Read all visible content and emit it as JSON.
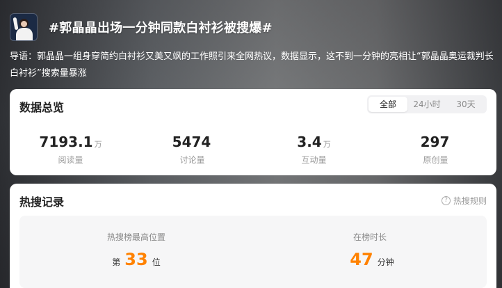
{
  "header": {
    "title": "#郭晶晶出场一分钟同款白衬衫被搜爆#"
  },
  "intro": "导语：郭晶晶一组身穿简约白衬衫又美又飒的工作照引来全网热议，数据显示，这不到一分钟的亮相让“郭晶晶奥运裁判长白衬衫”搜索量暴涨",
  "overview": {
    "title": "数据总览",
    "tabs": [
      "全部",
      "24小时",
      "30天"
    ],
    "active_tab": "全部",
    "stats": [
      {
        "value": "7193.1",
        "unit": "万",
        "label": "阅读量"
      },
      {
        "value": "5474",
        "unit": "",
        "label": "讨论量"
      },
      {
        "value": "3.4",
        "unit": "万",
        "label": "互动量"
      },
      {
        "value": "297",
        "unit": "",
        "label": "原创量"
      }
    ]
  },
  "record": {
    "title": "热搜记录",
    "rules_label": "热搜规则",
    "peak": {
      "label": "热搜榜最高位置",
      "prefix": "第",
      "value": "33",
      "suffix": "位"
    },
    "duration": {
      "label": "在榜时长",
      "value": "47",
      "suffix": "分钟"
    }
  },
  "colors": {
    "accent": "#ff8200"
  }
}
